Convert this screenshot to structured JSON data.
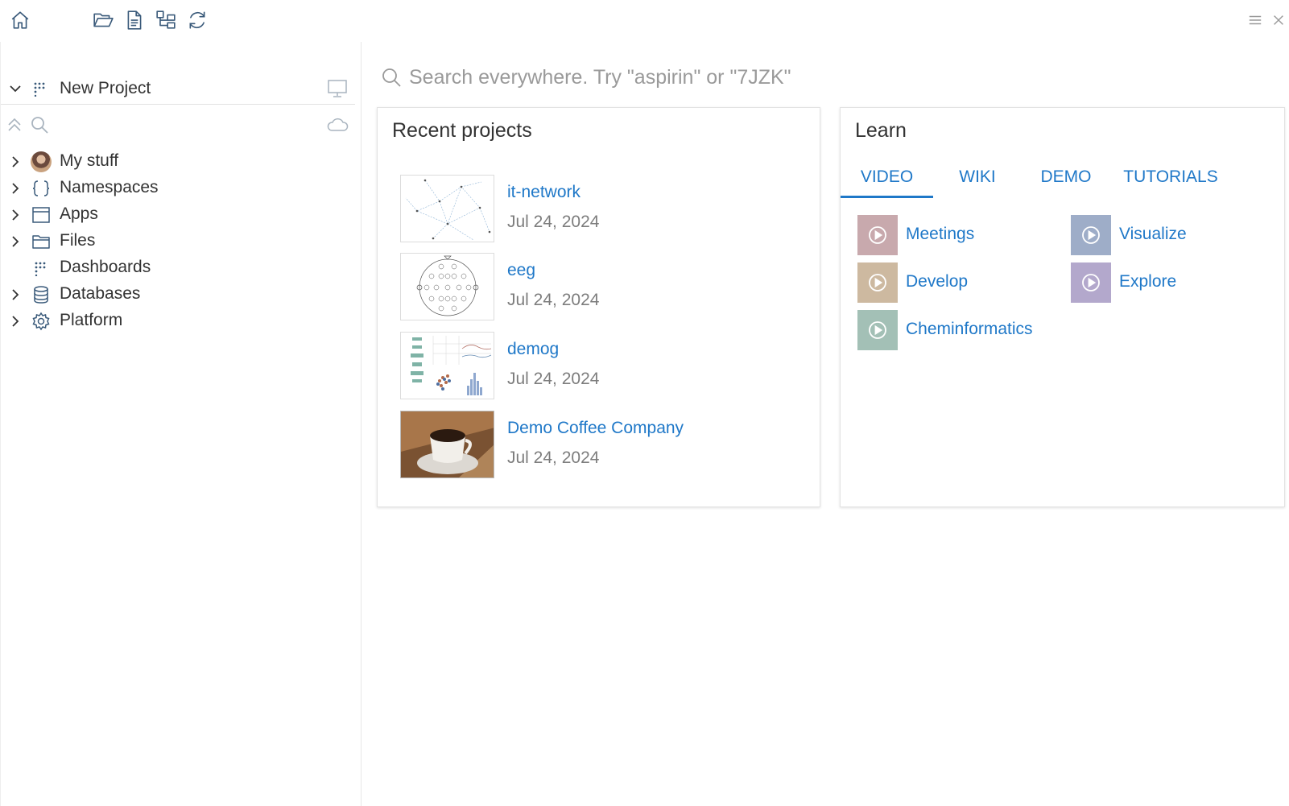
{
  "toolbar": {
    "icons": [
      "home-icon",
      "open-folder-icon",
      "document-icon",
      "tree-structure-icon",
      "refresh-icon"
    ],
    "window_icons": [
      "menu-icon",
      "close-icon"
    ]
  },
  "sidebar": {
    "project": {
      "label": "New Project"
    },
    "tree": [
      {
        "label": "My stuff",
        "icon": "avatar",
        "expandable": true
      },
      {
        "label": "Namespaces",
        "icon": "braces-icon",
        "expandable": true
      },
      {
        "label": "Apps",
        "icon": "window-icon",
        "expandable": true
      },
      {
        "label": "Files",
        "icon": "folder-icon",
        "expandable": true
      },
      {
        "label": "Dashboards",
        "icon": "dashboard-grid-icon",
        "expandable": false
      },
      {
        "label": "Databases",
        "icon": "database-icon",
        "expandable": true
      },
      {
        "label": "Platform",
        "icon": "gear-icon",
        "expandable": true
      }
    ]
  },
  "search": {
    "placeholder": "Search everywhere. Try \"aspirin\" or \"7JZK\""
  },
  "recent": {
    "title": "Recent projects",
    "projects": [
      {
        "name": "it-network",
        "date": "Jul 24, 2024"
      },
      {
        "name": "eeg",
        "date": "Jul 24, 2024"
      },
      {
        "name": "demog",
        "date": "Jul 24, 2024"
      },
      {
        "name": "Demo Coffee Company",
        "date": "Jul 24, 2024"
      }
    ]
  },
  "learn": {
    "title": "Learn",
    "tabs": [
      {
        "label": "VIDEO",
        "active": true
      },
      {
        "label": "WIKI",
        "active": false
      },
      {
        "label": "DEMO",
        "active": false
      },
      {
        "label": "TUTORIALS",
        "active": false
      }
    ],
    "videos": [
      {
        "label": "Meetings",
        "color": "#c8a9ad"
      },
      {
        "label": "Visualize",
        "color": "#9eadc8"
      },
      {
        "label": "Develop",
        "color": "#cdb9a0"
      },
      {
        "label": "Explore",
        "color": "#b3a8cc"
      },
      {
        "label": "Cheminformatics",
        "color": "#a3c0b6"
      }
    ]
  },
  "colors": {
    "accent": "#1f78c8",
    "muted_text": "#7d7d7d"
  }
}
